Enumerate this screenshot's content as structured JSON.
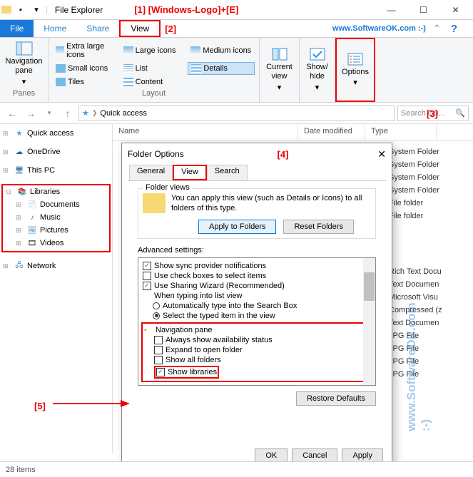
{
  "titlebar": {
    "title": "File Explorer"
  },
  "annotations": {
    "a1": "[1] [Windows-Logo]+[E]",
    "a2": "[2]",
    "a3": "[3]",
    "a4": "[4]",
    "a5": "[5]"
  },
  "tabs": {
    "file": "File",
    "home": "Home",
    "share": "Share",
    "view": "View"
  },
  "watermark_url": "www.SoftwareOK.com :-)",
  "ribbon": {
    "panes": {
      "nav_pane": "Navigation pane",
      "label": "Panes"
    },
    "layout": {
      "items": [
        "Extra large icons",
        "Large icons",
        "Small icons",
        "List",
        "Tiles",
        "Content",
        "Medium icons",
        "Details"
      ],
      "label": "Layout"
    },
    "current_view": "Current view",
    "show_hide": "Show/ hide",
    "options": "Options"
  },
  "addressbar": {
    "path": "Quick access"
  },
  "search": {
    "placeholder": "Search Qu..."
  },
  "columns": {
    "name": "Name",
    "date": "Date modified",
    "type": "Type"
  },
  "sidebar": {
    "quick_access": "Quick access",
    "onedrive": "OneDrive",
    "this_pc": "This PC",
    "libraries": "Libraries",
    "documents": "Documents",
    "music": "Music",
    "pictures": "Pictures",
    "videos": "Videos",
    "network": "Network"
  },
  "types": [
    "System Folder",
    "System Folder",
    "System Folder",
    "System Folder",
    "File folder",
    "File folder",
    "",
    "",
    "Rich Text Docu",
    "Text Documen",
    "Microsoft Visu",
    "Compressed (z",
    "Text Documen",
    "JPG File",
    "JPG File",
    "JPG File",
    "JPG File"
  ],
  "dialog": {
    "title": "Folder Options",
    "tabs": {
      "general": "General",
      "view": "View",
      "search": "Search"
    },
    "folder_views": {
      "label": "Folder views",
      "text": "You can apply this view (such as Details or Icons) to all folders of this type.",
      "apply": "Apply to Folders",
      "reset": "Reset Folders"
    },
    "advanced_label": "Advanced settings:",
    "advanced": {
      "show_sync": "Show sync provider notifications",
      "use_check": "Use check boxes to select items",
      "use_sharing": "Use Sharing Wizard (Recommended)",
      "when_typing": "When typing into list view",
      "auto_type": "Automatically type into the Search Box",
      "select_typed": "Select the typed item in the view",
      "nav_pane": "Navigation pane",
      "always_avail": "Always show availability status",
      "expand_open": "Expand to open folder",
      "show_all": "Show all folders",
      "show_lib": "Show libraries"
    },
    "restore": "Restore Defaults",
    "ok": "OK",
    "cancel": "Cancel",
    "apply": "Apply"
  },
  "status": {
    "items": "28 items"
  }
}
